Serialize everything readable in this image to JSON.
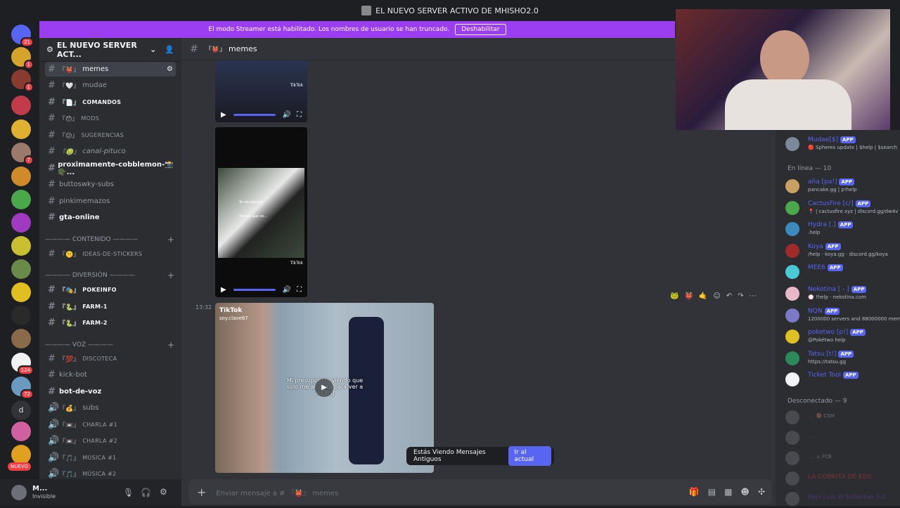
{
  "window": {
    "title": "EL NUEVO SERVER ACTIVO DE MHISHO2.0"
  },
  "banner": {
    "text": "El modo Streamer está habilitado. Los nombres de usuario se han truncado.",
    "button": "Deshabilitar"
  },
  "guild_badges": [
    "21",
    "1",
    "1",
    "7",
    "124",
    "72",
    "NUEVO"
  ],
  "guild_letter": "d",
  "server": {
    "name": "EL NUEVO SERVER ACT..."
  },
  "channels": [
    {
      "emo": "『👹』",
      "name": "memes"
    },
    {
      "emo": "『🤍』",
      "name": "mudae"
    },
    {
      "emo": "『📄』",
      "name": "COMANDOS"
    },
    {
      "emo": "『😯』",
      "name": "MODS"
    },
    {
      "emo": "『😕』",
      "name": "SUGERENCIAS"
    },
    {
      "emo": "『🤢』",
      "name": "canal-pituco"
    },
    {
      "emo": "",
      "name": "proximamente-cobblemon-📸🪖..."
    },
    {
      "emo": "",
      "name": "buttoswky-subs"
    },
    {
      "emo": "",
      "name": "pinkimemazos"
    },
    {
      "emo": "",
      "name": "gta-online"
    }
  ],
  "category_contenido": "———— CONTENIDO ————",
  "channel_stickers": {
    "emo": "『🤫』",
    "name": "IDEAS-DE-STICKERS"
  },
  "category_diversion": "———— DIVERSIÓN ————",
  "channels_div": [
    {
      "emo": "『🎭』",
      "name": "POKEINFO"
    },
    {
      "emo": "『🐍』",
      "name": "FARM-1"
    },
    {
      "emo": "『🐍』",
      "name": "FARM-2"
    }
  ],
  "category_voz": "———— VOZ ————",
  "channels_voz": [
    {
      "emo": "『💯』",
      "name": "DISCOTECA"
    },
    {
      "emo": "",
      "name": "kick-bot"
    },
    {
      "emo": "",
      "name": "bot-de-voz"
    },
    {
      "emo": "『💰』",
      "name": "subs"
    },
    {
      "emo": "『📼』",
      "name": "CHARLA #1"
    },
    {
      "emo": "『📼』",
      "name": "CHARLA #2"
    },
    {
      "emo": "『🎵』",
      "name": "MÚSICA #1"
    },
    {
      "emo": "『🎵』",
      "name": "MÚSICA #2"
    }
  ],
  "user": {
    "name": "M...",
    "status": "Invisible"
  },
  "chat": {
    "channel_emo": "『👹』",
    "channel": "memes"
  },
  "video1": {
    "overlay": "TikTok"
  },
  "video2": {
    "overlay": "TikTok",
    "caption1": "Yo recogiendo",
    "caption2": "Verdes que se...",
    "handle": "TikTok"
  },
  "message": {
    "time": "13:32"
  },
  "video3": {
    "brand": "TikTok",
    "handle": "soy.clave67",
    "caption": "Mi presupuesto viendo que solo me alcanza para ver a los BSJ"
  },
  "toast": {
    "text": "Estás Viendo Mensajes Antiguos",
    "button": "Ir al actual"
  },
  "composer": {
    "placeholder": "Enviar mensaje a # 『👹』 memes"
  },
  "app_label": "APP",
  "members_top": {
    "name": "Mudae[$]",
    "status": "🔴 Spheres update | $help | $search"
  },
  "online_header": "En línea — 10",
  "online": [
    {
      "name": "aña [pa!]",
      "status": "pancake.gg | p!help",
      "app": true,
      "color": "#5865f2"
    },
    {
      "name": "CactusFire [c/]",
      "status": "📍 | cactusfire.xyz | discord.gg/dw4v",
      "app": true,
      "color": "#5865f2"
    },
    {
      "name": "Hydra [.]",
      "status": ".help",
      "app": true,
      "color": "#5865f2"
    },
    {
      "name": "Koya",
      "status": "/help · koya.gg · discord.gg/koya",
      "app": true,
      "color": "#5865f2"
    },
    {
      "name": "MEE6",
      "status": "",
      "app": true,
      "color": "#5865f2"
    },
    {
      "name": "Nekotina [ - ]",
      "status": "💮 !help · nekotina.com",
      "app": true,
      "color": "#5865f2"
    },
    {
      "name": "NQN",
      "status": "1200000 servers and 88000000 mem",
      "app": true,
      "color": "#5865f2"
    },
    {
      "name": "poketwo [p!]",
      "status": "@Pokétwo help",
      "app": true,
      "color": "#5865f2"
    },
    {
      "name": "Tatsu [t!]",
      "status": "https://tatsu.gg",
      "app": true,
      "color": "#5865f2"
    },
    {
      "name": "Ticket Tool",
      "status": "",
      "app": true,
      "color": "#5865f2"
    }
  ],
  "offline_header": "Desconectado — 9",
  "offline": [
    {
      "name": "...",
      "status": "🟤 CSM",
      "color": "#a23a3a"
    },
    {
      "name": "...",
      "status": "",
      "color": "#a23a3a"
    },
    {
      "name": "...",
      "status": "⚔ FCB",
      "color": "#a23a3a"
    },
    {
      "name": "LA COBRITA DE EEG",
      "status": "",
      "color": "#e03a3a"
    },
    {
      "name": "Papi Luis el Soberbio 3.0",
      "status": "",
      "color": "#7a3ad0"
    }
  ]
}
